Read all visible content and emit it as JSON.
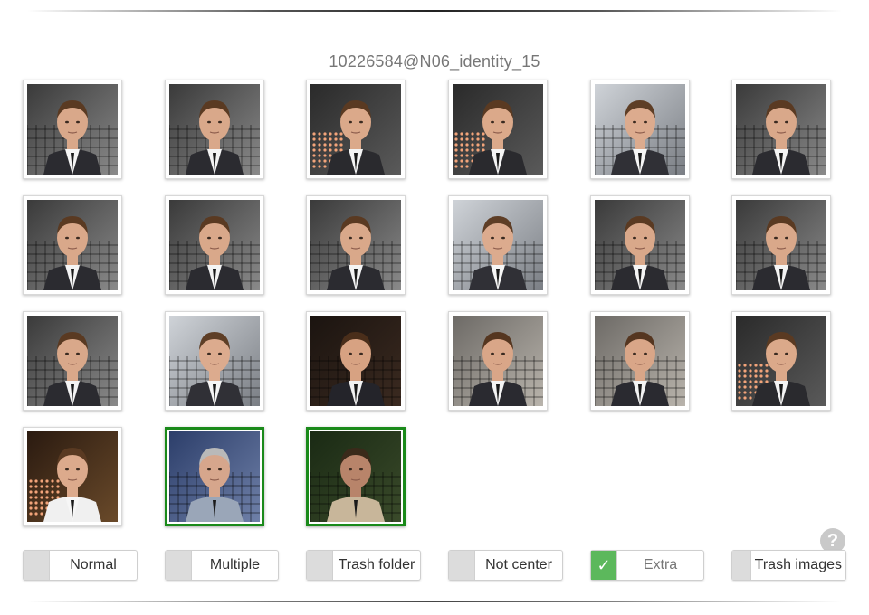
{
  "title": "10226584@N06_identity_15",
  "colors": {
    "selected_border": "#1a8a1a",
    "toggle_on": "#5cb85c",
    "toggle_off": "#dcdcdc"
  },
  "thumbnails": [
    {
      "selected": false,
      "scene": "stage"
    },
    {
      "selected": false,
      "scene": "stage"
    },
    {
      "selected": false,
      "scene": "stage-lights"
    },
    {
      "selected": false,
      "scene": "stage-lights"
    },
    {
      "selected": false,
      "scene": "stage-truss"
    },
    {
      "selected": false,
      "scene": "stage"
    },
    {
      "selected": false,
      "scene": "stage"
    },
    {
      "selected": false,
      "scene": "stage"
    },
    {
      "selected": false,
      "scene": "stage"
    },
    {
      "selected": false,
      "scene": "stage-truss"
    },
    {
      "selected": false,
      "scene": "stage"
    },
    {
      "selected": false,
      "scene": "stage"
    },
    {
      "selected": false,
      "scene": "stage"
    },
    {
      "selected": false,
      "scene": "stage-truss"
    },
    {
      "selected": false,
      "scene": "dark"
    },
    {
      "selected": false,
      "scene": "crowd"
    },
    {
      "selected": false,
      "scene": "crowd"
    },
    {
      "selected": false,
      "scene": "stage-lights"
    },
    {
      "selected": false,
      "scene": "dark-lights"
    },
    {
      "selected": true,
      "scene": "blue-shirt"
    },
    {
      "selected": true,
      "scene": "beige-blur"
    }
  ],
  "toggles": [
    {
      "label": "Normal",
      "checked": false
    },
    {
      "label": "Multiple",
      "checked": false
    },
    {
      "label": "Trash folder",
      "checked": false
    },
    {
      "label": "Not center",
      "checked": false
    },
    {
      "label": "Extra",
      "checked": true,
      "check_glyph": "✓"
    },
    {
      "label": "Trash images",
      "checked": false
    }
  ],
  "help": {
    "glyph": "?"
  }
}
